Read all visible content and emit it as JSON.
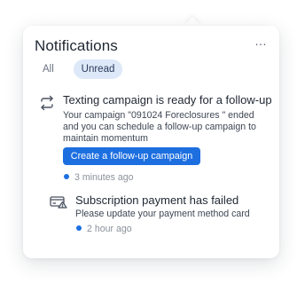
{
  "header": {
    "title": "Notifications",
    "more_label": "…"
  },
  "tabs": [
    {
      "label": "All",
      "active": false
    },
    {
      "label": "Unread",
      "active": true
    }
  ],
  "notifications": [
    {
      "icon": "repeat-icon",
      "title": "Texting campaign is ready for a follow-up",
      "body": "Your campaign \"091024 Foreclosures \" ended and you can schedule a follow-up campaign to maintain momentum",
      "action_label": "Create a follow-up campaign",
      "time": "3 minutes ago",
      "unread": true
    },
    {
      "icon": "card-warning-icon",
      "title": "Subscription payment has failed",
      "body": "Please update your payment method card",
      "time": "2 hour ago",
      "unread": true
    }
  ],
  "colors": {
    "accent": "#1d6fe0",
    "tab_active_bg": "#dde8f8",
    "text": "#1f2733",
    "muted": "#8b919b"
  }
}
